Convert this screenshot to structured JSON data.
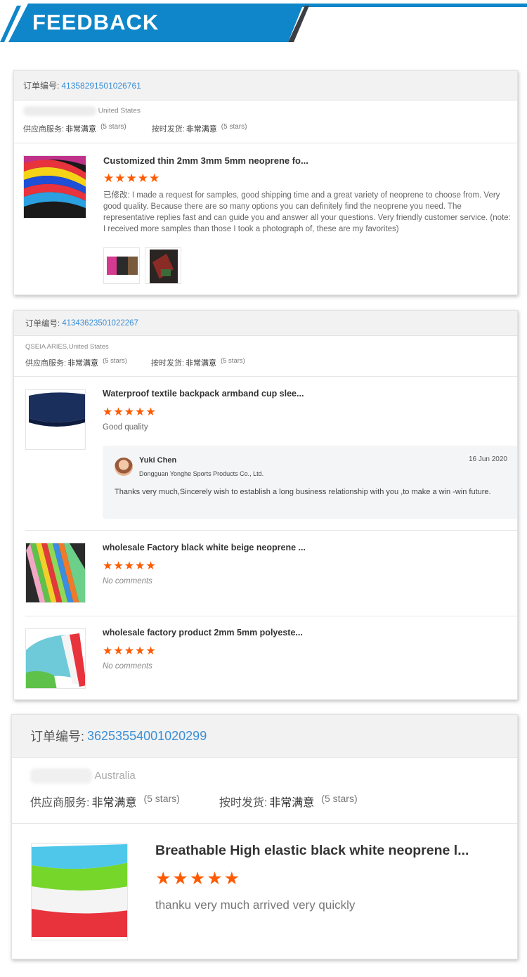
{
  "banner": {
    "title": "FEEDBACK"
  },
  "labels": {
    "order_prefix": "订单编号:",
    "supplier_service": "供应商服务:",
    "on_time_delivery": "按时发货:"
  },
  "orders": [
    {
      "order_number": "413582915010267​61",
      "country": "United States",
      "supplier_value": "非常满意",
      "supplier_stars": "(5 stars)",
      "delivery_value": "非常满意",
      "delivery_stars": "(5 stars)",
      "items": [
        {
          "title": "Customized thin 2mm 3mm 5mm neoprene fo...",
          "stars": "★★★★★",
          "comment": "已修改: I made a request for samples, good shipping time and a great variety of neoprene to choose from. Very good quality. Because there are so many options you can definitely find the neoprene you need. The representative replies fast and can guide you and answer all your questions. Very friendly customer service. (note: I received more samples than those I took a photograph of, these are my favorites)"
        }
      ]
    },
    {
      "order_number": "41343623501022267",
      "country": "QSEIA ARIES,United States",
      "supplier_value": "非常满意",
      "supplier_stars": "(5 stars)",
      "delivery_value": "非常满意",
      "delivery_stars": "(5 stars)",
      "items": [
        {
          "title": "Waterproof textile backpack armband cup slee...",
          "stars": "★★★★★",
          "comment": "Good quality",
          "reply": {
            "name": "Yuki Chen",
            "company": "Dongguan Yonghe Sports Products Co., Ltd.",
            "date": "16 Jun 2020",
            "text": "Thanks very much,Sincerely wish to establish a long business relationship with you ,to make a win -win future."
          }
        },
        {
          "title": "wholesale Factory black white beige neoprene ...",
          "stars": "★★★★★",
          "comment": "No comments"
        },
        {
          "title": "wholesale factory product 2mm 5mm polyeste...",
          "stars": "★★★★★",
          "comment": "No comments"
        }
      ]
    },
    {
      "order_number": "36253554001020299",
      "country": "Australia",
      "supplier_value": "非常满意",
      "supplier_stars": "(5 stars)",
      "delivery_value": "非常满意",
      "delivery_stars": "(5 stars)",
      "items": [
        {
          "title": "Breathable High elastic black white neoprene l...",
          "stars": "★★★★★",
          "comment": "thanku very much arrived very quickly"
        }
      ]
    }
  ]
}
